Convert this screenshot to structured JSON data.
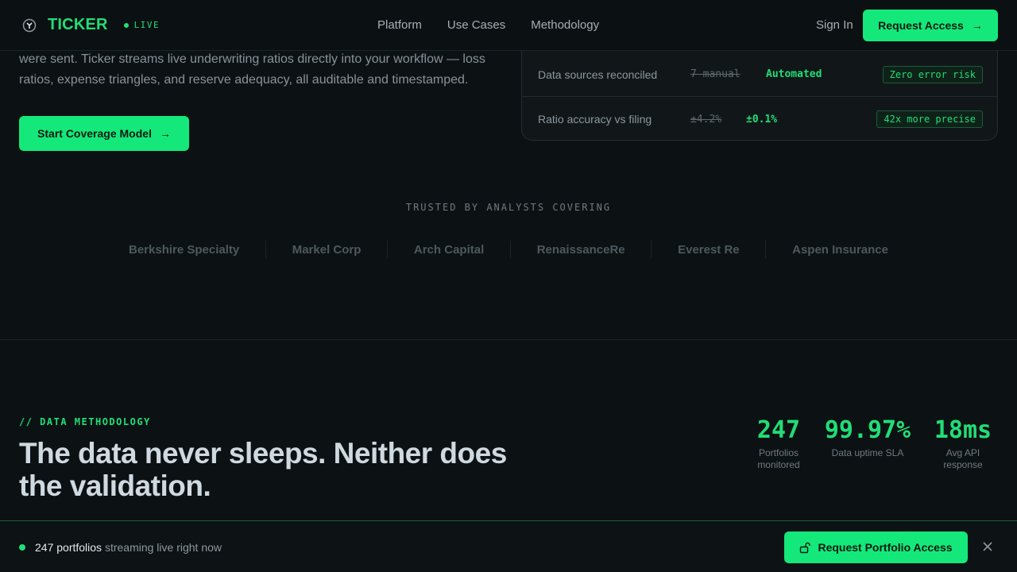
{
  "nav": {
    "brand": "TICKER",
    "live": "LIVE",
    "links": [
      "Platform",
      "Use Cases",
      "Methodology"
    ],
    "sign_in": "Sign In",
    "request_access": "Request Access"
  },
  "hero": {
    "text": "were sent. Ticker streams live underwriting ratios directly into your workflow — loss ratios, expense triangles, and reserve adequacy, all auditable and timestamped.",
    "cta": "Start Coverage Model"
  },
  "comparison": [
    {
      "label": "Data sources reconciled",
      "old": "7 manual",
      "new": "Automated",
      "badge": "Zero error risk"
    },
    {
      "label": "Ratio accuracy vs filing",
      "old": "±4.2%",
      "new": "±0.1%",
      "badge": "42x more precise"
    }
  ],
  "trusted": {
    "title": "TRUSTED BY ANALYSTS COVERING",
    "logos": [
      "Berkshire Specialty",
      "Markel Corp",
      "Arch Capital",
      "RenaissanceRe",
      "Everest Re",
      "Aspen Insurance"
    ]
  },
  "methodology": {
    "eyebrow": "// DATA METHODOLOGY",
    "heading": "The data never sleeps. Neither does the validation.",
    "stats": [
      {
        "value": "247",
        "label": "Portfolios monitored"
      },
      {
        "value": "99.97%",
        "label": "Data uptime SLA"
      },
      {
        "value": "18ms",
        "label": "Avg API response"
      }
    ]
  },
  "sticky": {
    "count": "247 portfolios",
    "rest": "streaming live right now",
    "cta": "Request Portfolio Access"
  },
  "colors": {
    "accent": "#15e87a",
    "background": "#0c1214"
  }
}
